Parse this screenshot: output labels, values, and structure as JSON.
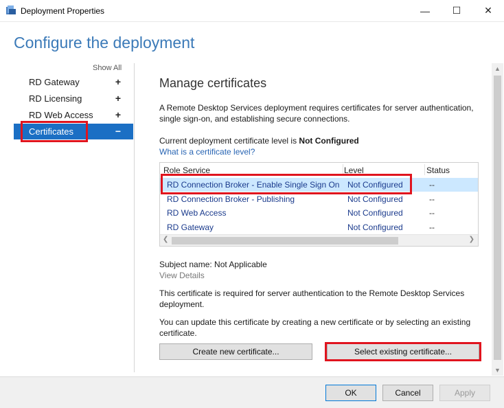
{
  "window": {
    "title": "Deployment Properties",
    "minimize_glyph": "—",
    "maximize_glyph": "☐",
    "close_glyph": "✕"
  },
  "page_title": "Configure the deployment",
  "nav": {
    "show_all": "Show All",
    "items": [
      {
        "label": "RD Gateway",
        "toggle": "+"
      },
      {
        "label": "RD Licensing",
        "toggle": "+"
      },
      {
        "label": "RD Web Access",
        "toggle": "+"
      },
      {
        "label": "Certificates",
        "toggle": "−",
        "active": true
      }
    ]
  },
  "content": {
    "section_title": "Manage certificates",
    "intro": "A Remote Desktop Services deployment requires certificates for server authentication, single sign-on, and establishing secure connections.",
    "current_level_prefix": "Current deployment certificate level is ",
    "current_level_value": "Not Configured",
    "level_link": "What is a certificate level?",
    "table": {
      "headers": [
        "Role Service",
        "Level",
        "Status"
      ],
      "rows": [
        {
          "role": "RD Connection Broker - Enable Single Sign On",
          "level": "Not Configured",
          "status": "--",
          "selected": true
        },
        {
          "role": "RD Connection Broker - Publishing",
          "level": "Not Configured",
          "status": "--"
        },
        {
          "role": "RD Web Access",
          "level": "Not Configured",
          "status": "--"
        },
        {
          "role": "RD Gateway",
          "level": "Not Configured",
          "status": "--"
        }
      ]
    },
    "subject_name": "Subject name: Not Applicable",
    "view_details": "View Details",
    "required_text": "This certificate is required for server authentication to the Remote Desktop Services deployment.",
    "update_text": "You can update this certificate by creating a new certificate or by selecting an existing certificate.",
    "create_button": "Create new certificate...",
    "select_button": "Select existing certificate..."
  },
  "footer": {
    "ok": "OK",
    "cancel": "Cancel",
    "apply": "Apply"
  },
  "colors": {
    "accent": "#1b6fc4",
    "highlight_box": "#e0141e",
    "title_blue": "#3b7ab8"
  }
}
